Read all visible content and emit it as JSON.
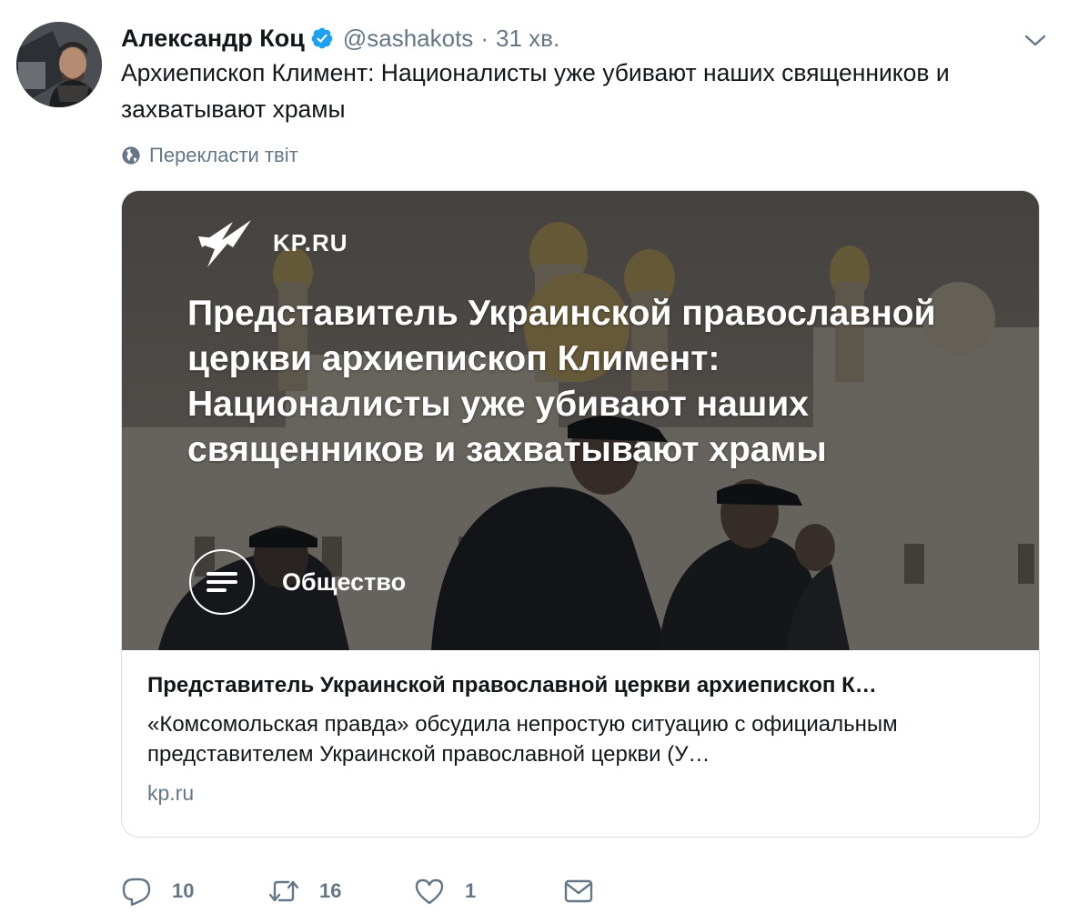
{
  "user": {
    "name": "Александр Коц",
    "handle": "@sashakots",
    "separator": "·",
    "time": "31 хв."
  },
  "tweet": {
    "text": "Архиепископ Климент: Националисты уже убивают наших священников и захватывают храмы",
    "translate_label": "Перекласти твіт"
  },
  "card": {
    "brand": "KP.RU",
    "headline": "Представитель Украинской православной церкви архиепископ Климент:  Националисты уже убивают наших священников и захватывают храмы",
    "category": "Общество",
    "title": "Представитель Украинской православной церкви архиепископ К…",
    "description": "«Комсомольская правда» обсудила непростую ситуацию с официальным представителем Украинской православной церкви (У…",
    "domain": "kp.ru"
  },
  "actions": {
    "reply_count": "10",
    "retweet_count": "16",
    "like_count": "1"
  },
  "icons": {
    "verified": "verified-badge-icon",
    "chevron": "chevron-down-icon",
    "globe": "globe-icon",
    "reply": "reply-icon",
    "retweet": "retweet-icon",
    "like": "heart-icon",
    "dm": "envelope-icon"
  },
  "colors": {
    "accent": "#1da1f2",
    "secondary_text": "#657786",
    "primary_text": "#14171a",
    "card_border": "#d8dee3"
  }
}
